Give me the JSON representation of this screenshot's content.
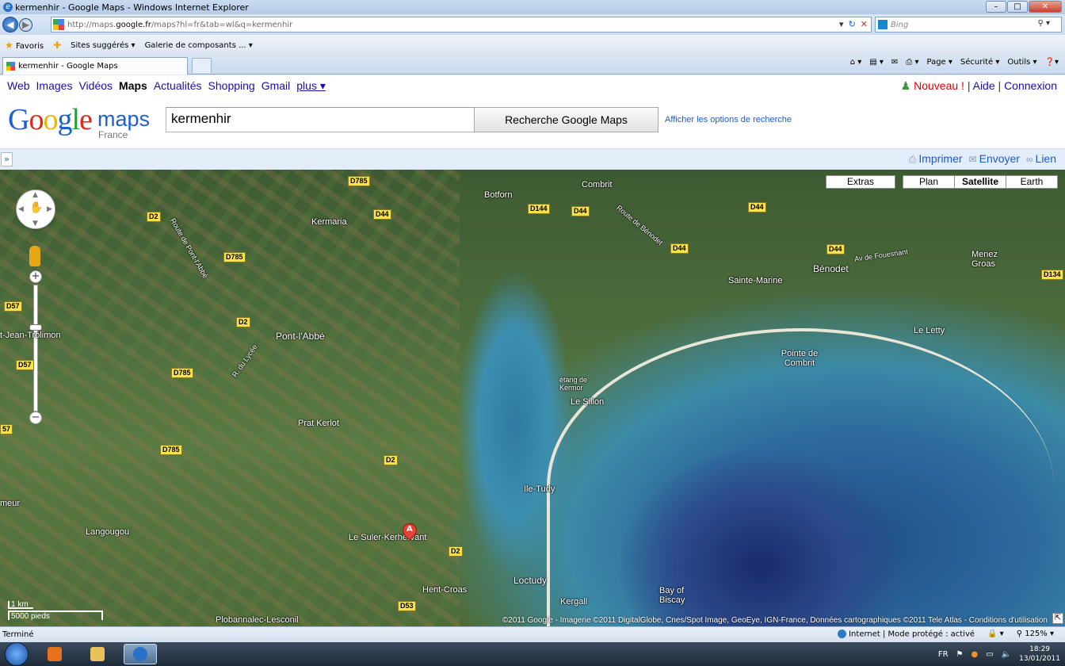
{
  "window": {
    "title": "kermenhir - Google Maps - Windows Internet Explorer"
  },
  "address": {
    "url_prefix": "http://maps.",
    "url_host": "google.fr",
    "url_rest": "/maps?hl=fr&tab=wl&q=kermenhir",
    "search_placeholder": "Bing"
  },
  "favorites": {
    "favoris": "Favoris",
    "suggested": "Sites suggérés ▾",
    "gallery": "Galerie de composants ... ▾"
  },
  "tab": {
    "title": "kermenhir - Google Maps"
  },
  "commands": {
    "page": "Page ▾",
    "security": "Sécurité ▾",
    "tools": "Outils ▾",
    "help": "❓▾"
  },
  "gbar": {
    "items": [
      "Web",
      "Images",
      "Vidéos",
      "Maps",
      "Actualités",
      "Shopping",
      "Gmail"
    ],
    "more": "plus",
    "new": "Nouveau !",
    "help": "Aide",
    "login": "Connexion",
    "sep": "|"
  },
  "header": {
    "logo_parts": [
      "G",
      "o",
      "o",
      "g",
      "l",
      "e"
    ],
    "maps": "maps",
    "country": "France",
    "query": "kermenhir",
    "search_button": "Recherche Google Maps",
    "options_link": "Afficher les options de recherche"
  },
  "strip": {
    "expand": "»",
    "print": "Imprimer",
    "send": "Envoyer",
    "link": "Lien"
  },
  "map_types": [
    "Extras",
    "Plan",
    "Satellite",
    "Earth"
  ],
  "map_labels": [
    "Kermaria",
    "Botforn",
    "Combrit",
    "Sainte-Marine",
    "Bénodet",
    "Menez Groas",
    "Pont-l'Abbé",
    "Le Letty",
    "Pointe de Combrit",
    "Prat Kerlot",
    "étang de Kermor",
    "Le Sillon",
    "Ile-Tudy",
    "Langougou",
    "Le Suler-Kerhervant",
    "Hent-Croas",
    "Loctudy",
    "Kergall",
    "Bay of Biscay",
    "t-Jean-Trolimon",
    "meur",
    "Av de Fouesnant",
    "Route de Bénodet",
    "Route de Pont-l'Abbé",
    "R. du Lycée",
    "Plobannalec-Lesconil"
  ],
  "roads": [
    "D785",
    "D2",
    "D44",
    "D144",
    "D44",
    "D44",
    "D44",
    "D44",
    "D134",
    "D785",
    "D57",
    "D2",
    "D57",
    "D785",
    "D785",
    "D2",
    "D2",
    "D53",
    "57"
  ],
  "marker": "A",
  "scale": {
    "km": "1 km",
    "feet": "5000 pieds"
  },
  "copyright": "©2011 Google - Imagerie ©2011 DigitalGlobe, Cnes/Spot Image, GeoEye, IGN-France, Données cartographiques ©2011 Tele Atlas - Conditions d'utilisation",
  "status": {
    "left": "Terminé",
    "zone": "Internet | Mode protégé : activé",
    "zoom": "125%"
  },
  "tray": {
    "lang": "FR",
    "time": "18:29",
    "date": "13/01/2011"
  },
  "colors": {
    "link": "#1a0dab",
    "accent": "#1a5dc8",
    "new": "#dd0000"
  }
}
